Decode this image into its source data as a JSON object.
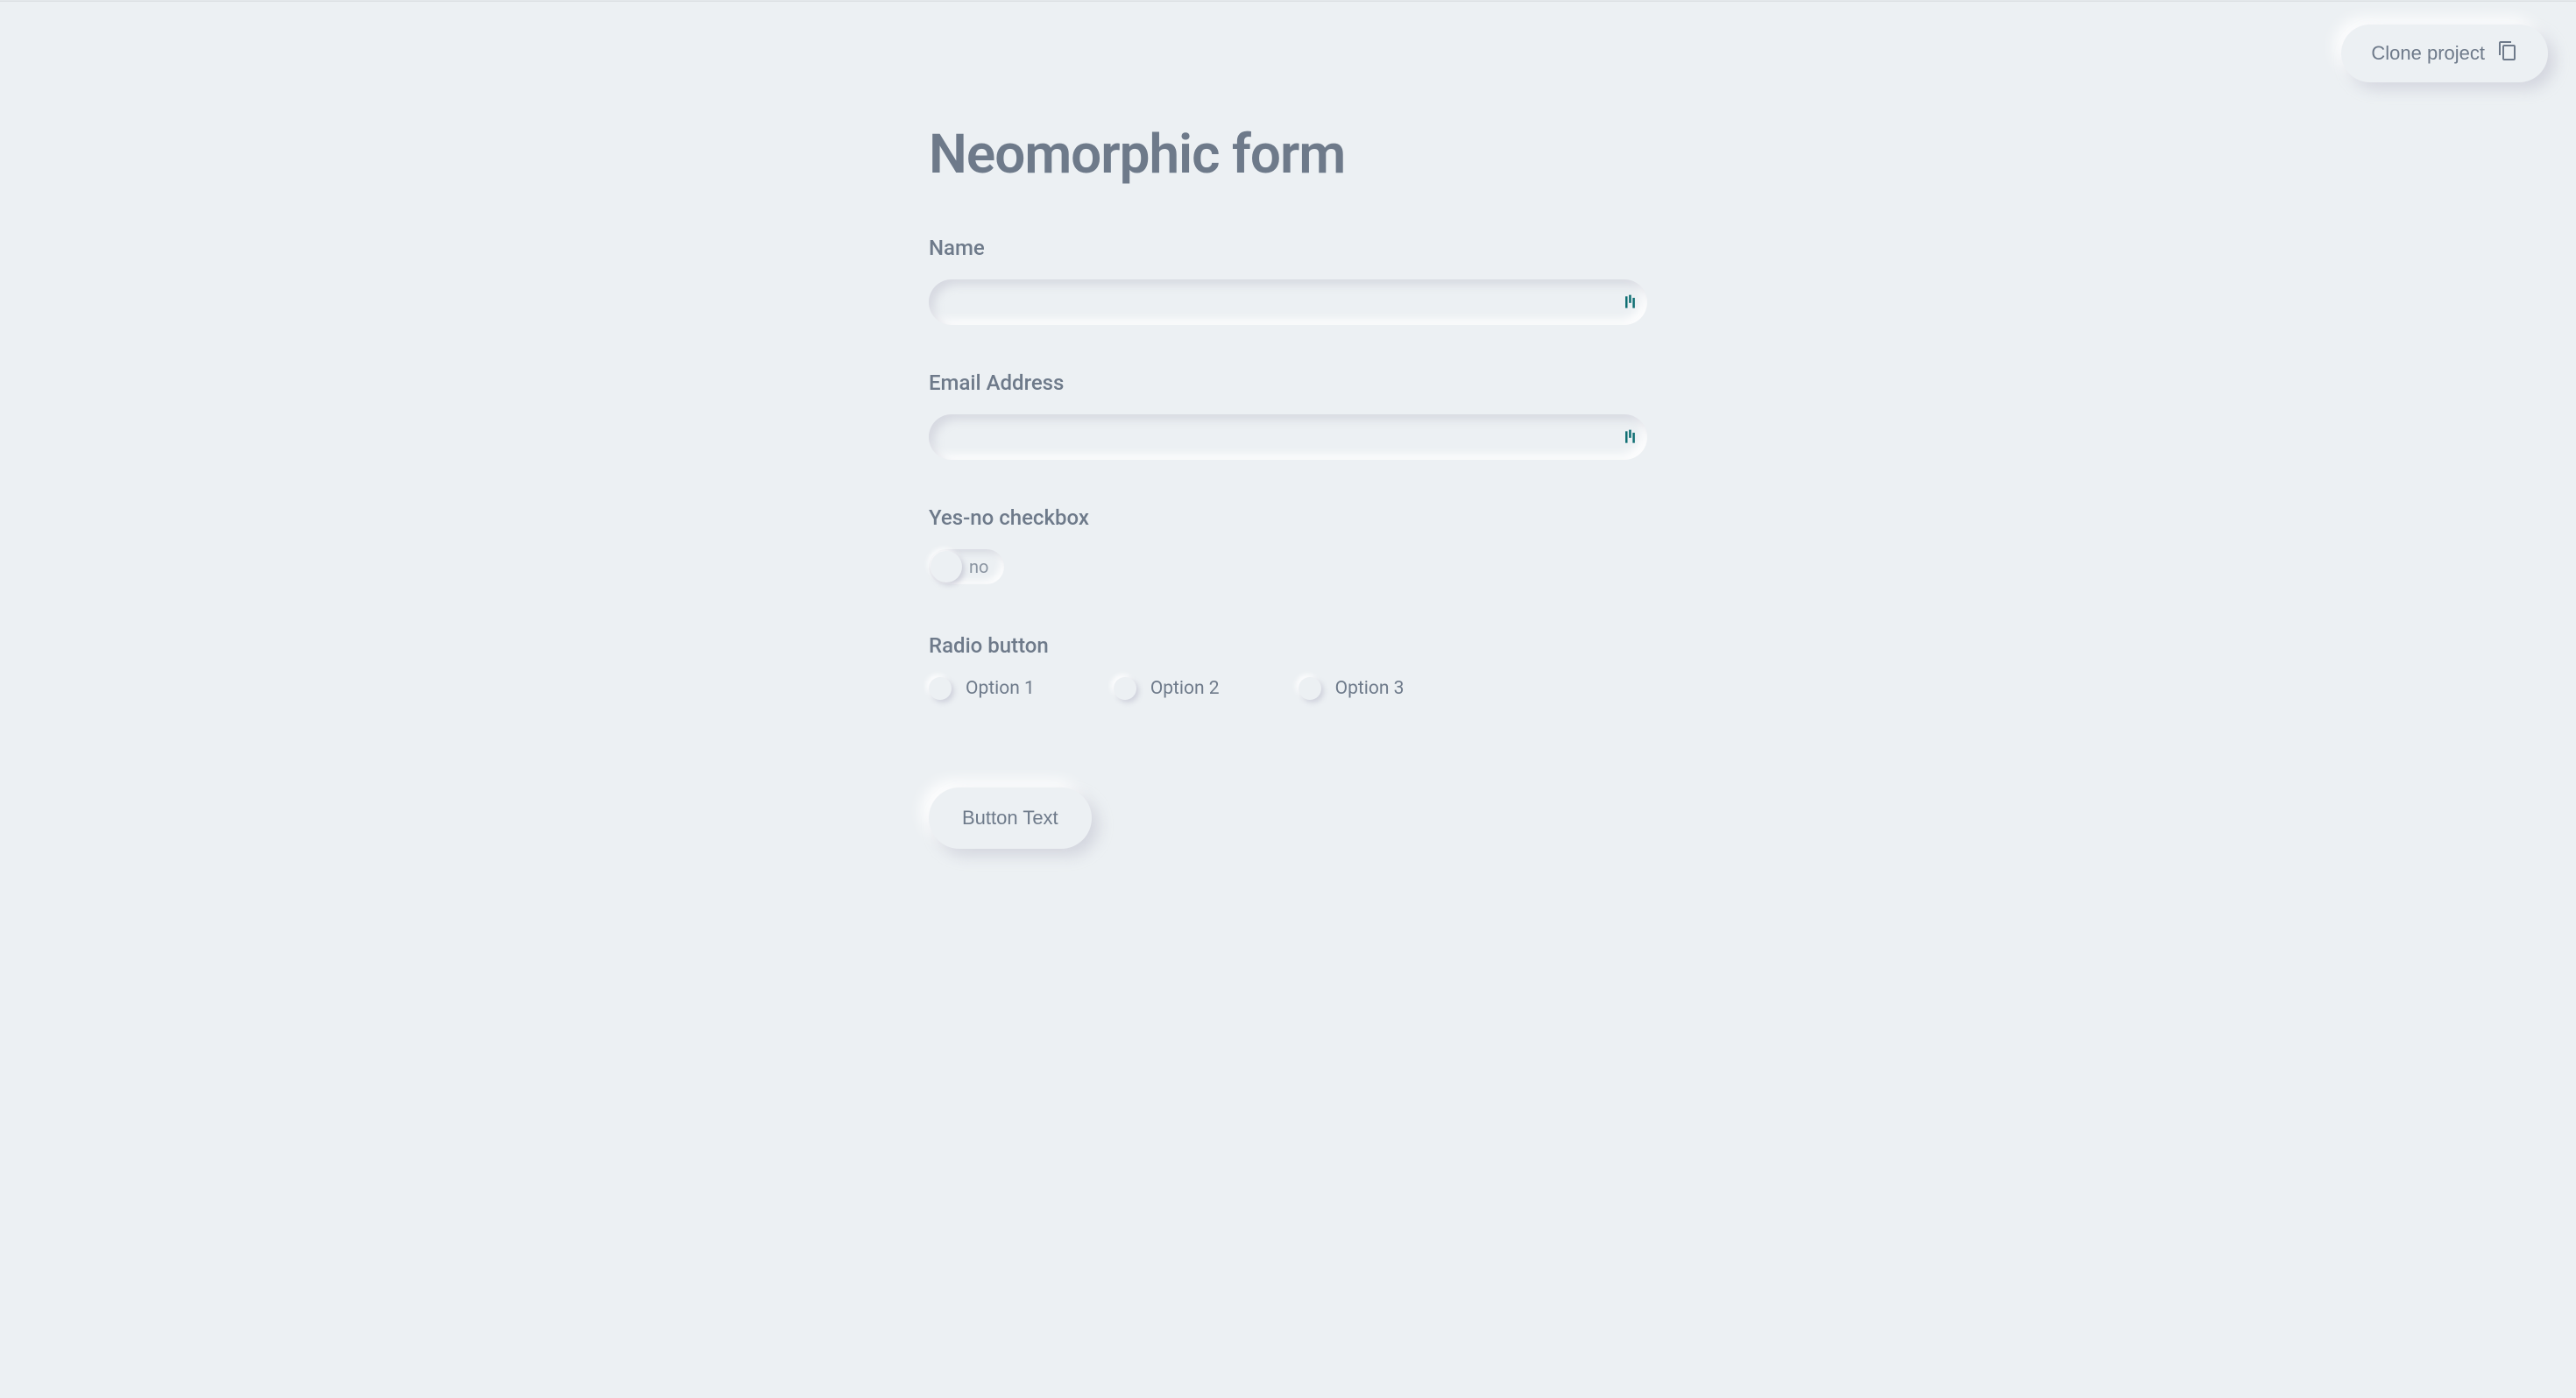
{
  "topbar": {
    "clone_label": "Clone project"
  },
  "page": {
    "title": "Neomorphic form"
  },
  "form": {
    "name_label": "Name",
    "name_value": "",
    "email_label": "Email Address",
    "email_value": "",
    "checkbox_label": "Yes-no checkbox",
    "toggle_state_text": "no",
    "radio_label": "Radio button",
    "radio_options": [
      {
        "label": "Option 1"
      },
      {
        "label": "Option 2"
      },
      {
        "label": "Option 3"
      }
    ],
    "submit_label": "Button Text"
  },
  "colors": {
    "background": "#ecf0f3",
    "text": "#6e7a8a",
    "accent_icon": "#0f6f73"
  }
}
